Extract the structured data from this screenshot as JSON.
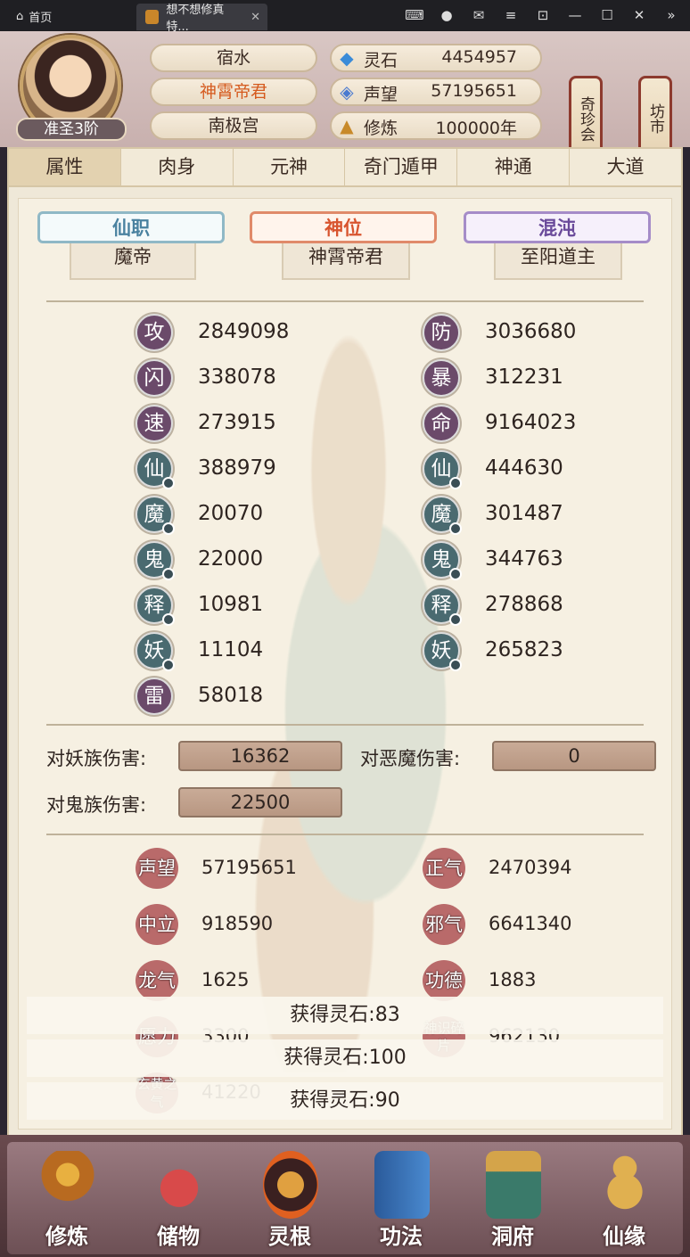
{
  "window": {
    "home_label": "首页",
    "tab_title": "想不想修真特..."
  },
  "player": {
    "rank": "准圣3阶",
    "server": "宿水",
    "title": "神霄帝君",
    "sect": "南极宫"
  },
  "resources": [
    {
      "name": "灵石",
      "value": "4454957",
      "icon": "crystal-icon"
    },
    {
      "name": "声望",
      "value": "57195651",
      "icon": "prestige-icon"
    },
    {
      "name": "修炼",
      "value": "100000年",
      "icon": "cultivation-icon"
    }
  ],
  "side_buttons": {
    "shop": "奇珍会",
    "market": "坊市"
  },
  "tabs": [
    "属性",
    "肉身",
    "元神",
    "奇门遁甲",
    "神通",
    "大道"
  ],
  "positions": [
    {
      "header": "仙职",
      "value": "魔帝"
    },
    {
      "header": "神位",
      "value": "神霄帝君"
    },
    {
      "header": "混沌",
      "value": "至阳道主"
    }
  ],
  "stats_left": [
    {
      "char": "攻",
      "value": "2849098"
    },
    {
      "char": "闪",
      "value": "338078"
    },
    {
      "char": "速",
      "value": "273915"
    },
    {
      "char": "仙",
      "value": "388979"
    },
    {
      "char": "魔",
      "value": "20070"
    },
    {
      "char": "鬼",
      "value": "22000"
    },
    {
      "char": "释",
      "value": "10981"
    },
    {
      "char": "妖",
      "value": "11104"
    },
    {
      "char": "雷",
      "value": "58018"
    }
  ],
  "stats_right": [
    {
      "char": "防",
      "value": "3036680"
    },
    {
      "char": "暴",
      "value": "312231"
    },
    {
      "char": "命",
      "value": "9164023"
    },
    {
      "char": "仙",
      "value": "444630"
    },
    {
      "char": "魔",
      "value": "301487"
    },
    {
      "char": "鬼",
      "value": "344763"
    },
    {
      "char": "释",
      "value": "278868"
    },
    {
      "char": "妖",
      "value": "265823"
    }
  ],
  "damage": [
    {
      "label": "对妖族伤害:",
      "value": "16362"
    },
    {
      "label": "对恶魔伤害:",
      "value": "0"
    },
    {
      "label": "对鬼族伤害:",
      "value": "22500"
    }
  ],
  "reputation": [
    {
      "label": "声望",
      "value": "57195651"
    },
    {
      "label": "正气",
      "value": "2470394"
    },
    {
      "label": "中立",
      "value": "918590"
    },
    {
      "label": "邪气",
      "value": "6641340"
    },
    {
      "label": "龙气",
      "value": "1625"
    },
    {
      "label": "功德",
      "value": "1883"
    },
    {
      "label": "愿力",
      "value": "3300"
    },
    {
      "label": "神识碎片",
      "value": "962130"
    },
    {
      "label": "玄黄之气",
      "value": "41220"
    }
  ],
  "toasts": [
    "获得灵石:83",
    "获得灵石:100",
    "获得灵石:90"
  ],
  "bottom_nav": [
    "修炼",
    "储物",
    "灵根",
    "功法",
    "洞府",
    "仙缘"
  ]
}
